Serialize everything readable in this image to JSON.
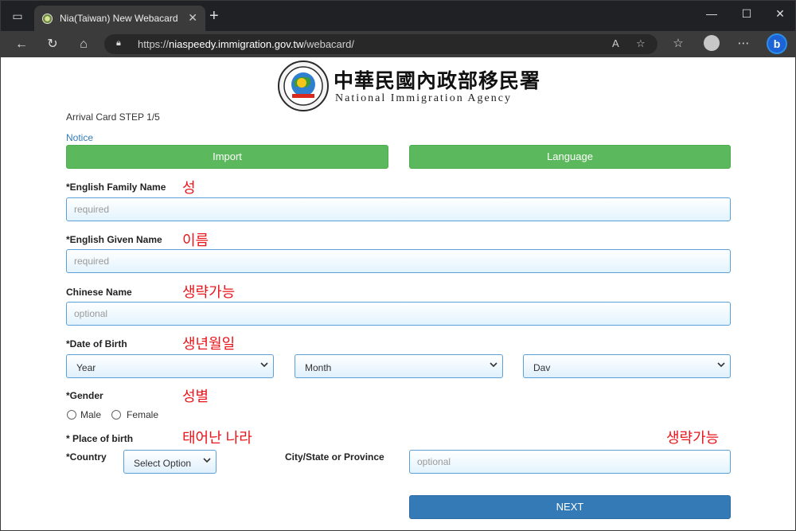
{
  "browser": {
    "tab_title": "Nia(Taiwan) New Webacard",
    "url_prefix": "https://",
    "url_host": "niaspeedy.immigration.gov.tw",
    "url_path": "/webacard/",
    "new_tab_glyph": "+",
    "close_glyph": "✕"
  },
  "header": {
    "agency_chinese": "中華民國內政部移民署",
    "agency_english": "National Immigration Agency"
  },
  "form": {
    "step_text": "Arrival Card STEP 1/5",
    "notice_link": "Notice",
    "import_button": "Import",
    "language_button": "Language",
    "family_name_label": "*English Family Name",
    "family_name_placeholder": "required",
    "given_name_label": "*English Given Name",
    "given_name_placeholder": "required",
    "chinese_name_label": "Chinese Name",
    "chinese_name_placeholder": "optional",
    "dob_label": "*Date of Birth",
    "dob_year": "Year",
    "dob_month": "Month",
    "dob_day": "Dav",
    "gender_label": "*Gender",
    "gender_male": "Male",
    "gender_female": "Female",
    "place_of_birth_label": "* Place of birth",
    "country_label": "*Country",
    "country_select": "Select Option",
    "city_label": "City/State or Province",
    "city_placeholder": "optional",
    "next_button": "NEXT"
  },
  "annotations": {
    "family_name": "성",
    "given_name": "이름",
    "chinese_name": "생략가능",
    "dob": "생년월일",
    "gender": "성별",
    "place_of_birth": "태어난 나라",
    "city": "생략가능"
  },
  "colors": {
    "green_button": "#5cb85c",
    "next_button": "#337ab7",
    "annotation_red": "#e8141a",
    "input_border": "#5ba0d9"
  }
}
